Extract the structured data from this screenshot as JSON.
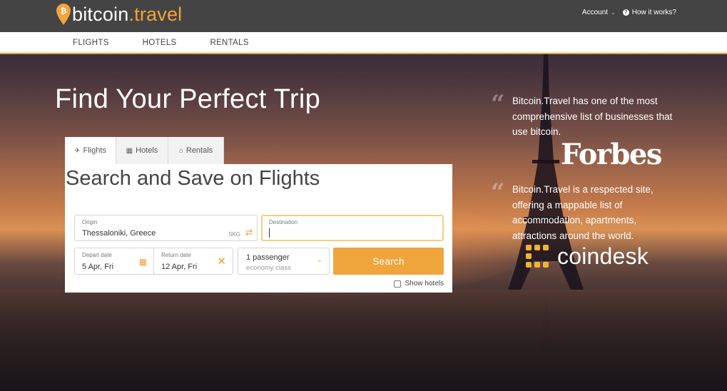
{
  "brand": {
    "name_part1": "bitcoin",
    "name_part2": ".travel",
    "accent_color": "#f2a33a"
  },
  "header": {
    "account_label": "Account",
    "how_label": "How it works?"
  },
  "nav": {
    "items": [
      {
        "label": "FLIGHTS"
      },
      {
        "label": "HOTELS"
      },
      {
        "label": "RENTALS"
      }
    ]
  },
  "hero": {
    "title": "Find Your Perfect Trip"
  },
  "search": {
    "tabs": [
      {
        "label": "Flights",
        "icon": "plane-icon"
      },
      {
        "label": "Hotels",
        "icon": "building-icon"
      },
      {
        "label": "Rentals",
        "icon": "home-icon"
      }
    ],
    "title": "Search and Save on Flights",
    "origin": {
      "label": "Origin",
      "value": "Thessaloniki, Greece",
      "code": "SKG"
    },
    "destination": {
      "label": "Destination",
      "value": ""
    },
    "depart": {
      "label": "Depart date",
      "value": "5 Apr, Fri"
    },
    "return": {
      "label": "Return date",
      "value": "12 Apr, Fri"
    },
    "passengers": {
      "main": "1 passenger",
      "sub": "economy class"
    },
    "search_button": "Search",
    "show_hotels": "Show hotels"
  },
  "quotes": [
    {
      "text": "Bitcoin.Travel has one of the most comprehensive list of businesses that use bitcoin.",
      "source": "Forbes"
    },
    {
      "text": "Bitcoin.Travel is a respected site, offering a mappable list of accommodation, apartments, attractions around the world.",
      "source": "coindesk"
    }
  ],
  "colors": {
    "accent": "#f29c32",
    "topbar": "#444444",
    "button": "#f0a43c"
  }
}
